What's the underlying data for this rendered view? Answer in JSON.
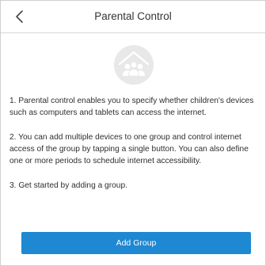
{
  "header": {
    "title": "Parental Control",
    "back_icon": "chevron-left-icon"
  },
  "hero": {
    "icon": "family-house-icon"
  },
  "main": {
    "paragraphs": [
      "1. Parental control enables you to specify whether children's devices such as computers and tablets can access the internet.",
      "2. You can add multiple devices to one group and control internet access of the group by tapping a single button. You can also define one or more periods to schedule internet accessibility.",
      "3. Get started by adding a group."
    ]
  },
  "footer": {
    "add_group_label": "Add Group"
  },
  "colors": {
    "accent": "#1e88d2",
    "icon_bg": "#e8e8e8",
    "text": "#2f2f2f"
  }
}
